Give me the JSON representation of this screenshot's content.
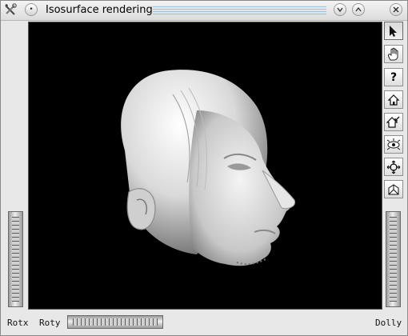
{
  "window": {
    "title": "Isosurface rendering"
  },
  "title_bar": {
    "icons": [
      "tools-icon",
      "menu-dot-icon",
      "minimize-icon",
      "maximize-icon",
      "close-icon"
    ]
  },
  "toolbar": {
    "tools": [
      {
        "name": "select-arrow-icon",
        "active": true
      },
      {
        "name": "hand-icon",
        "active": false
      },
      {
        "name": "help-icon",
        "active": false
      },
      {
        "name": "home-icon",
        "active": false
      },
      {
        "name": "set-home-icon",
        "active": false
      },
      {
        "name": "view-all-icon",
        "active": false
      },
      {
        "name": "seek-icon",
        "active": false
      },
      {
        "name": "perspective-icon",
        "active": false
      }
    ]
  },
  "wheels": {
    "rotx_label": "Rotx",
    "roty_label": "Roty",
    "dolly_label": "Dolly"
  },
  "viewer": {
    "background": "#000000",
    "content": "rendered isosurface of a head"
  },
  "colors": {
    "title_accent": "#8ab0d4",
    "chrome": "#e8e8e8",
    "viewer_bg": "#000000"
  }
}
